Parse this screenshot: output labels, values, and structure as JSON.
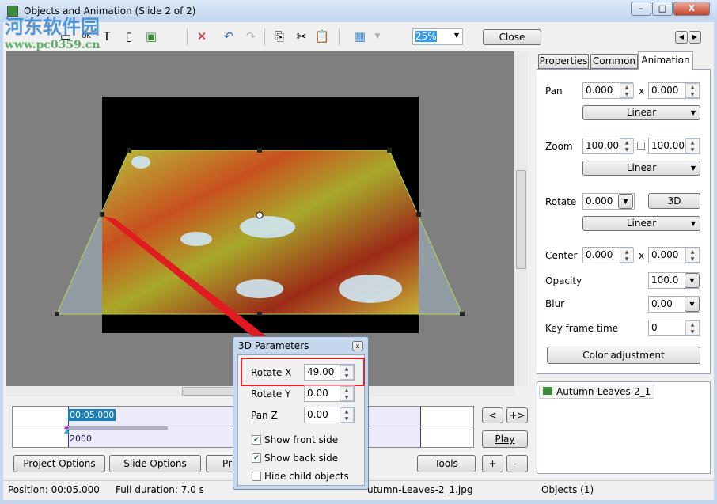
{
  "window": {
    "title": "Objects and Animation  (Slide 2 of 2)"
  },
  "watermark": {
    "name": "河东软件园",
    "url": "www.pc0359.cn"
  },
  "toolbar": {
    "zoom_value": "25%",
    "close_label": "Close"
  },
  "tabs": [
    {
      "label": "Properties"
    },
    {
      "label": "Common"
    },
    {
      "label": "Animation"
    }
  ],
  "animation": {
    "pan_label": "Pan",
    "pan_x": "0.000",
    "pan_y": "0.000",
    "pan_mode": "Linear",
    "zoom_label": "Zoom",
    "zoom_x": "100.000",
    "zoom_y": "100.000",
    "zoom_mode": "Linear",
    "rotate_label": "Rotate",
    "rotate_value": "0.000",
    "rotate_3d_label": "3D",
    "rotate_mode": "Linear",
    "center_label": "Center",
    "center_x": "0.000",
    "center_y": "0.000",
    "opacity_label": "Opacity",
    "opacity_value": "100.0",
    "blur_label": "Blur",
    "blur_value": "0.00",
    "keyframe_label": "Key frame time",
    "keyframe_value": "0",
    "color_adjustment_label": "Color adjustment",
    "x_sep": "x"
  },
  "objects": [
    {
      "name": "Autumn-Leaves-2_1"
    }
  ],
  "timeline": {
    "time": "00:05.000",
    "keyframe": "2000"
  },
  "nav": {
    "prev": "<",
    "next": "+>",
    "play": "Play",
    "plus": "+",
    "minus": "-"
  },
  "bottom_buttons": {
    "project_options": "Project Options",
    "slide_options": "Slide Options",
    "preview_partial": "Pr",
    "tools": "Tools"
  },
  "dialog": {
    "title": "3D Parameters",
    "rotate_x_label": "Rotate X",
    "rotate_x": "49.00",
    "rotate_y_label": "Rotate Y",
    "rotate_y": "0.00",
    "pan_z_label": "Pan Z",
    "pan_z": "0.00",
    "show_front": {
      "label": "Show front side",
      "checked": true
    },
    "show_back": {
      "label": "Show back side",
      "checked": true
    },
    "hide_child": {
      "label": "Hide child objects",
      "checked": false
    }
  },
  "status": {
    "position": "Position:  00:05.000",
    "duration": "Full duration:  7.0 s",
    "file": "utumn-Leaves-2_1.jpg",
    "objects": "Objects (1)"
  },
  "colors": {
    "highlight": "#d9262c",
    "selection": "#1a7fb8"
  }
}
